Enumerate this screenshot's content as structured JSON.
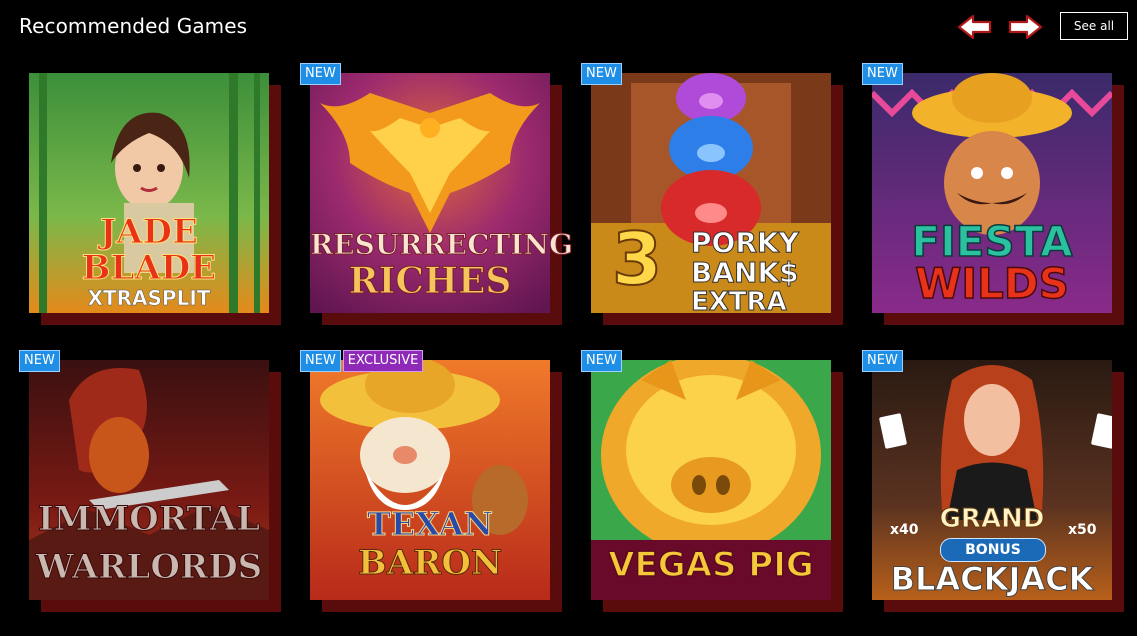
{
  "header": {
    "title": "Recommended Games",
    "see_all_label": "See all",
    "prev_icon": "arrow-left-icon",
    "next_icon": "arrow-right-icon"
  },
  "colors": {
    "badge_new": "#1e8ee6",
    "badge_exclusive": "#8e29b8",
    "tile_shadow": "#5a0c0c",
    "background": "#000000"
  },
  "games": [
    {
      "id": "jade",
      "badges": [],
      "title_lines": [
        "JADE",
        "BLADE"
      ],
      "subtitle": "XTRASPLIT"
    },
    {
      "id": "resurrecting",
      "badges": [
        "NEW"
      ],
      "title_lines": [
        "RESURRECTING",
        "RICHES"
      ],
      "subtitle": ""
    },
    {
      "id": "porky",
      "badges": [
        "NEW"
      ],
      "title_lines": [
        "PORKY",
        "BANK$",
        "EXTRA"
      ],
      "subtitle": "3"
    },
    {
      "id": "fiesta",
      "badges": [
        "NEW"
      ],
      "title_lines": [
        "FIESTA",
        "WILDS"
      ],
      "subtitle": ""
    },
    {
      "id": "immortal",
      "badges": [
        "NEW"
      ],
      "title_lines": [
        "IMMORTAL",
        "WARLORDS"
      ],
      "subtitle": ""
    },
    {
      "id": "texan",
      "badges": [
        "NEW",
        "EXCLUSIVE"
      ],
      "title_lines": [
        "TEXAN",
        "BARON"
      ],
      "subtitle": ""
    },
    {
      "id": "vegas",
      "badges": [
        "NEW"
      ],
      "title_lines": [
        "VEGAS PIG"
      ],
      "subtitle": ""
    },
    {
      "id": "blackjack",
      "badges": [
        "NEW"
      ],
      "title_lines": [
        "GRAND",
        "BONUS",
        "BLACKJACK"
      ],
      "subtitle": "",
      "left_mult": "x40",
      "right_mult": "x50"
    }
  ]
}
